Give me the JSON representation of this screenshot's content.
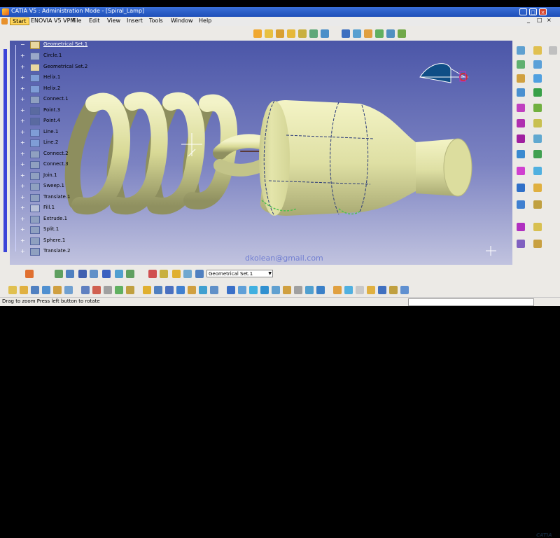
{
  "window": {
    "title": "CATIA V5 : Administration Mode - [Spiral_Lamp]",
    "controls": {
      "minimize": "_",
      "maximize": "□",
      "close": "×"
    }
  },
  "menu": {
    "start": "Start",
    "items": [
      "ENOVIA V5 VPM",
      "File",
      "Edit",
      "View",
      "Insert",
      "Tools",
      "Window",
      "Help"
    ]
  },
  "tree": {
    "root": "Geometrical Set.1",
    "items": [
      {
        "label": "Circle.1"
      },
      {
        "label": "Geometrical Set.2"
      },
      {
        "label": "Helix.1"
      },
      {
        "label": "Helix.2"
      },
      {
        "label": "Connect.1"
      },
      {
        "label": "Point.3"
      },
      {
        "label": "Point.4"
      },
      {
        "label": "Line.1"
      },
      {
        "label": "Line.2"
      },
      {
        "label": "Connect.2"
      },
      {
        "label": "Connect.3"
      },
      {
        "label": "Join.1"
      },
      {
        "label": "Sweep.1"
      },
      {
        "label": "Translate.1"
      },
      {
        "label": "Fill.1"
      },
      {
        "label": "Extrude.1"
      },
      {
        "label": "Split.1"
      },
      {
        "label": "Sphere.1"
      },
      {
        "label": "Translate.2"
      }
    ]
  },
  "toolbar": {
    "current_set": "Geometrical Set.1",
    "dropdown_arrow": "▼"
  },
  "watermark": "dkolean@gmail.com",
  "brand": "CATIA",
  "status": {
    "message": "Drag to zoom  Press left button to rotate"
  },
  "colors": {
    "model": "#dfe0a2",
    "viewport_top": "#4b56a8",
    "viewport_bottom": "#c1c3df",
    "titlebar": "#2a5fcc"
  }
}
